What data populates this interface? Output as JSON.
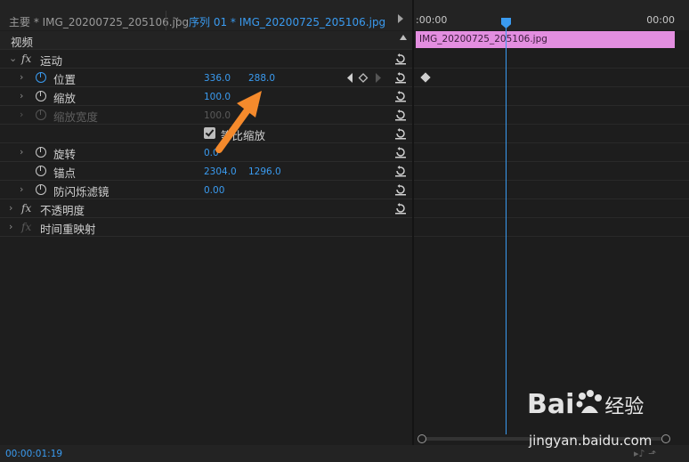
{
  "header": {
    "source_tab": "主要 * IMG_20200725_205106.jpg",
    "sequence_tab": "序列 01 * IMG_20200725_205106.jpg"
  },
  "timeline": {
    "ruler_start": ":00:00",
    "ruler_end": "00:00",
    "clip_name": "IMG_20200725_205106.jpg"
  },
  "section": {
    "label": "视频"
  },
  "effects": {
    "motion": {
      "label": "运动",
      "position": {
        "label": "位置",
        "x": "336.0",
        "y": "288.0"
      },
      "scale": {
        "label": "缩放",
        "value": "100.0"
      },
      "scale_width": {
        "label": "缩放宽度",
        "value": "100.0"
      },
      "uniform_scale": {
        "label": "等比缩放",
        "checked": true
      },
      "rotation": {
        "label": "旋转",
        "value": "0.0"
      },
      "anchor": {
        "label": "锚点",
        "x": "2304.0",
        "y": "1296.0"
      },
      "anti_flicker": {
        "label": "防闪烁滤镜",
        "value": "0.00"
      }
    },
    "opacity": {
      "label": "不透明度"
    },
    "time_remap": {
      "label": "时间重映射"
    }
  },
  "footer": {
    "timecode": "00:00:01:19"
  },
  "watermark": {
    "logo": "Bai",
    "logo_suffix": "经验",
    "url": "jingyan.baidu.com"
  },
  "colors": {
    "accent": "#3a9bf0",
    "clip": "#e38ee0",
    "arrow": "#f58a2c"
  }
}
